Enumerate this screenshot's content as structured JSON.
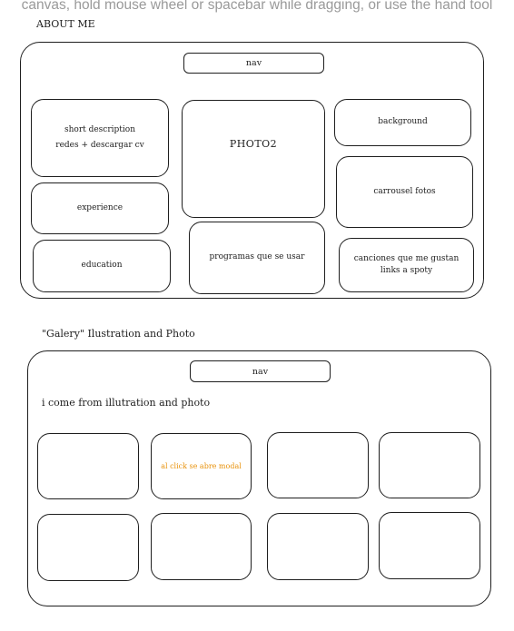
{
  "hint_text": "canvas, hold mouse wheel or spacebar while dragging, or use the hand tool",
  "about": {
    "title": "ABOUT ME",
    "nav_label": "nav",
    "short_description": "short description",
    "redes": "redes + descargar cv",
    "experience": "experience",
    "education": "education",
    "photo": "PHOTO2",
    "programas": "programas que se usar",
    "background": "background",
    "carrousel": "carrousel fotos",
    "canciones_line1": "canciones que me gustan",
    "canciones_line2": "links a spoty"
  },
  "gallery": {
    "title": "\"Galery\" Ilustration and Photo",
    "nav_label": "nav",
    "intro": "i come from illutration and photo",
    "modal_note": "al click se abre modal",
    "accent_color": "#e8920c"
  }
}
